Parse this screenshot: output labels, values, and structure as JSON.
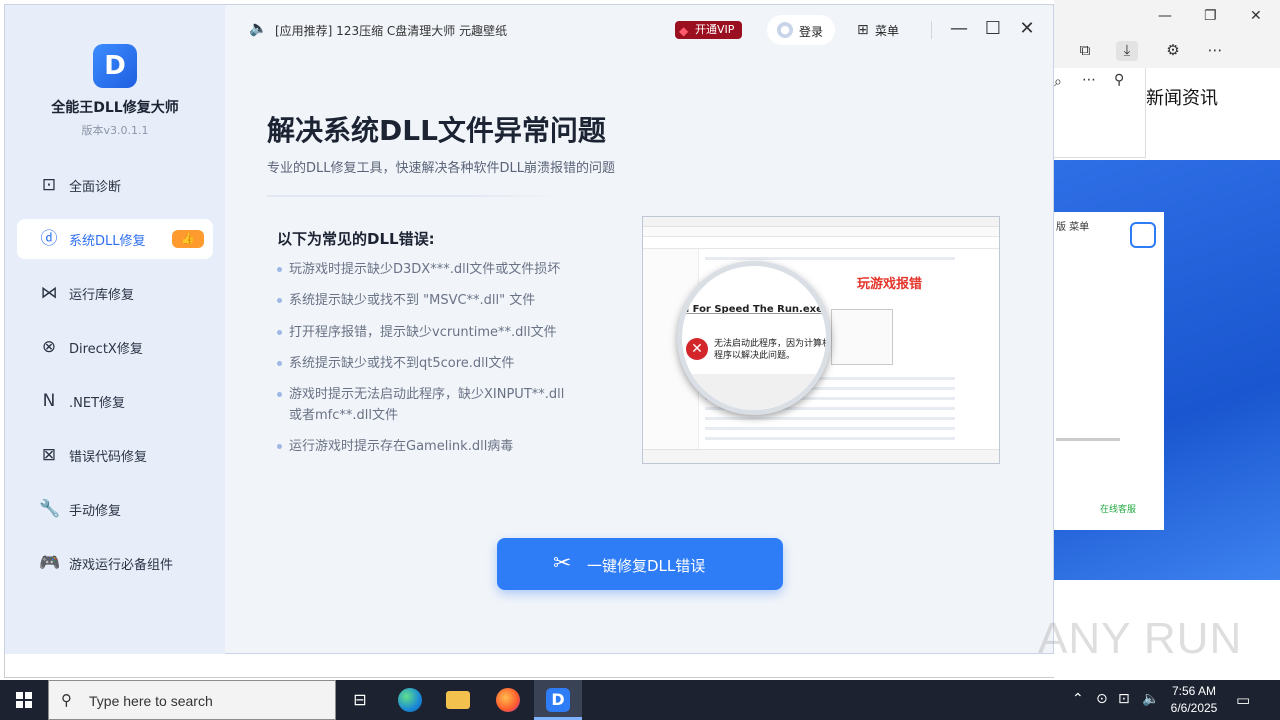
{
  "app": {
    "name": "全能王DLL修复大师",
    "version": "版本v3.0.1.1",
    "logo_glyph": "D"
  },
  "sidebar": {
    "items": [
      {
        "label": "全面诊断",
        "icon": "diagnosis-icon",
        "glyph": "⊡"
      },
      {
        "label": "系统DLL修复",
        "icon": "dll-icon",
        "glyph": "ⓓ",
        "active": true,
        "badge": "👍"
      },
      {
        "label": "运行库修复",
        "icon": "runtime-icon",
        "glyph": "⋈"
      },
      {
        "label": "DirectX修复",
        "icon": "directx-icon",
        "glyph": "⊗"
      },
      {
        "label": ".NET修复",
        "icon": "dotnet-icon",
        "glyph": "N"
      },
      {
        "label": "错误代码修复",
        "icon": "error-code-icon",
        "glyph": "⊠"
      },
      {
        "label": "手动修复",
        "icon": "wrench-icon",
        "glyph": "🔧"
      },
      {
        "label": "游戏运行必备组件",
        "icon": "gamepad-icon",
        "glyph": "🎮"
      }
    ]
  },
  "topbar": {
    "notice": "[应用推荐] 123压缩  C盘清理大师  元趣壁纸",
    "vip_label": "开通VIP",
    "login_label": "登录",
    "menu_label": "菜单"
  },
  "content": {
    "headline": "解决系统DLL文件异常问题",
    "subheadline": "专业的DLL修复工具，快速解决各种软件DLL崩溃报错的问题",
    "errors_title": "以下为常见的DLL错误:",
    "errors": [
      "玩游戏时提示缺少D3DX***.dll文件或文件损坏",
      "系统提示缺少或找不到 \"MSVC**.dll\" 文件",
      "打开程序报错，提示缺少vcruntime**.dll文件",
      "系统提示缺少或找不到qt5core.dll文件",
      "游戏时提示无法启动此程序，缺少XINPUT**.dll或者mfc**.dll文件",
      "运行游戏时提示存在Gamelink.dll病毒"
    ],
    "illustration": {
      "game_error": "玩游戏报错",
      "exe_title": "d For Speed The Run.exe - 系统错误",
      "message_line1": "无法启动此程序，因为计算机中丢",
      "message_line2": "程序以解决此问题。"
    },
    "fix_button": "一键修复DLL错误"
  },
  "background_browser": {
    "news_label": "新闻资讯",
    "card_text": "版  菜单",
    "card_footer": "在线客服"
  },
  "watermark": "ANY RUN",
  "taskbar": {
    "search_placeholder": "Type here to search",
    "time": "7:56 AM",
    "date": "6/6/2025"
  },
  "colors": {
    "accent": "#2e7cf6",
    "sidebar_bg": "#e7eef9",
    "badge": "#ff9a2e",
    "vip": "#9b1020",
    "error_red": "#e4352b"
  }
}
